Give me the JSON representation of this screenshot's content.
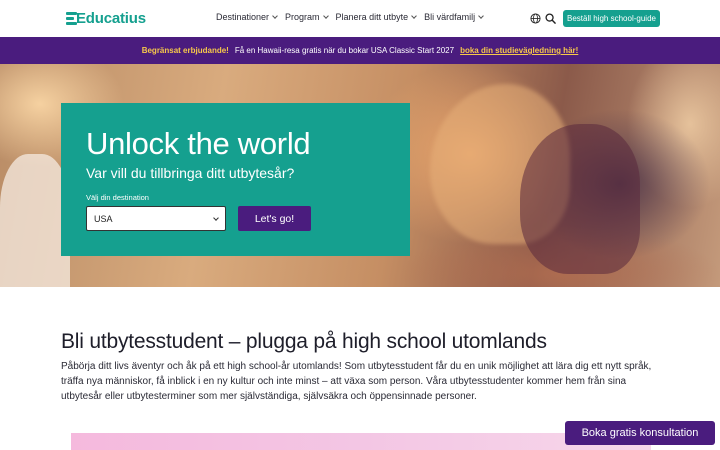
{
  "header": {
    "logo_text": "Educatius",
    "brand_color": "#15a08f",
    "nav": [
      {
        "label": "Destinationer"
      },
      {
        "label": "Program"
      },
      {
        "label": "Planera ditt utbyte"
      },
      {
        "label": "Bli värdfamilj"
      }
    ],
    "icons": [
      "globe-icon",
      "search-icon"
    ],
    "cta_label": "Beställ high school-guide"
  },
  "promo": {
    "limited": "Begränsat erbjudande!",
    "text": "Få en Hawaii-resa gratis när du bokar USA Classic Start 2027",
    "link": "boka din studievägledning här!",
    "bg_color": "#4a1c7e",
    "accent_color": "#f7c94a"
  },
  "hero": {
    "title": "Unlock the world",
    "subtitle": "Var vill du tillbringa ditt utbytesår?",
    "dest_label": "Välj din destination",
    "dest_value": "USA",
    "go_label": "Let's go!"
  },
  "main": {
    "heading": "Bli utbytesstudent – plugga på high school utomlands",
    "paragraph": "Påbörja ditt livs äventyr och åk på ett high school-år utomlands! Som utbytesstudent får du en unik möjlighet att lära dig ett nytt språk, träffa nya människor, få inblick i en ny kultur och inte minst – att växa som person. Våra utbytesstudenter kommer hem från sina utbytesår eller utbytesterminer som mer självständiga, självsäkra och öppensinnade personer."
  },
  "floating_cta": {
    "label": "Boka gratis konsultation"
  }
}
